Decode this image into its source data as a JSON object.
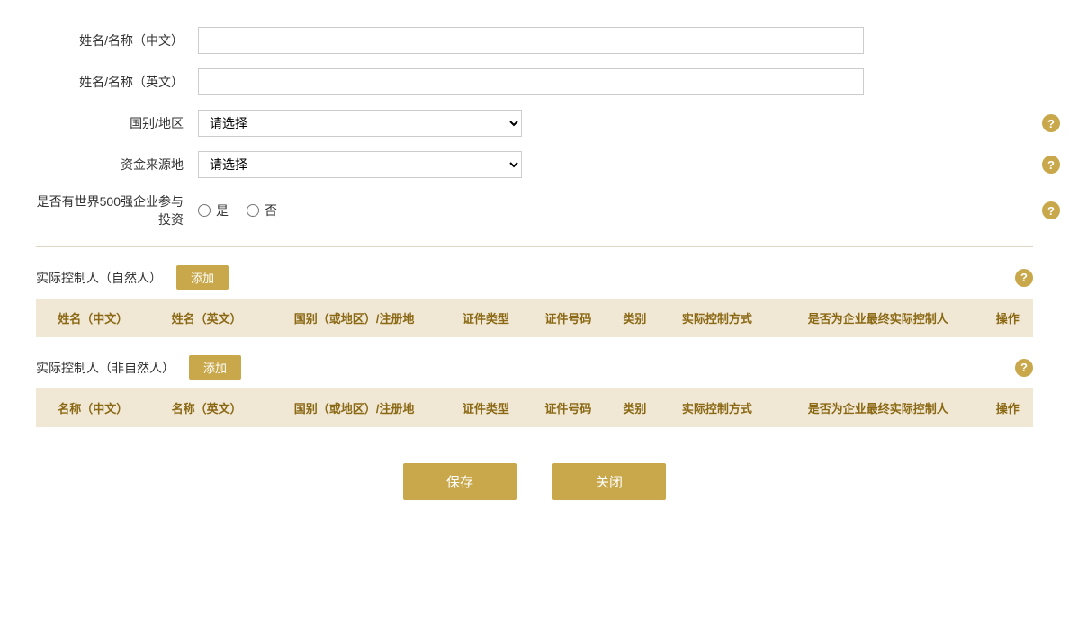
{
  "form": {
    "name_cn_label": "姓名/名称（中文）",
    "name_en_label": "姓名/名称（英文）",
    "country_label": "国别/地区",
    "fund_source_label": "资金来源地",
    "fortune500_label": "是否有世界500强企业参与投资",
    "fortune500_yes": "是",
    "fortune500_no": "否",
    "name_cn_value": "",
    "name_en_value": "",
    "country_placeholder": "请选择",
    "fund_source_placeholder": "请选择"
  },
  "natural_person_section": {
    "title": "实际控制人（自然人）",
    "add_btn": "添加",
    "columns": [
      "姓名（中文）",
      "姓名（英文）",
      "国别（或地区）/注册地",
      "证件类型",
      "证件号码",
      "类别",
      "实际控制方式",
      "是否为企业最终实际控制人",
      "操作"
    ]
  },
  "non_natural_person_section": {
    "title": "实际控制人（非自然人）",
    "add_btn": "添加",
    "columns": [
      "名称（中文）",
      "名称（英文）",
      "国别（或地区）/注册地",
      "证件类型",
      "证件号码",
      "类别",
      "实际控制方式",
      "是否为企业最终实际控制人",
      "操作"
    ]
  },
  "actions": {
    "save_label": "保存",
    "close_label": "关闭"
  },
  "icons": {
    "help": "?"
  }
}
